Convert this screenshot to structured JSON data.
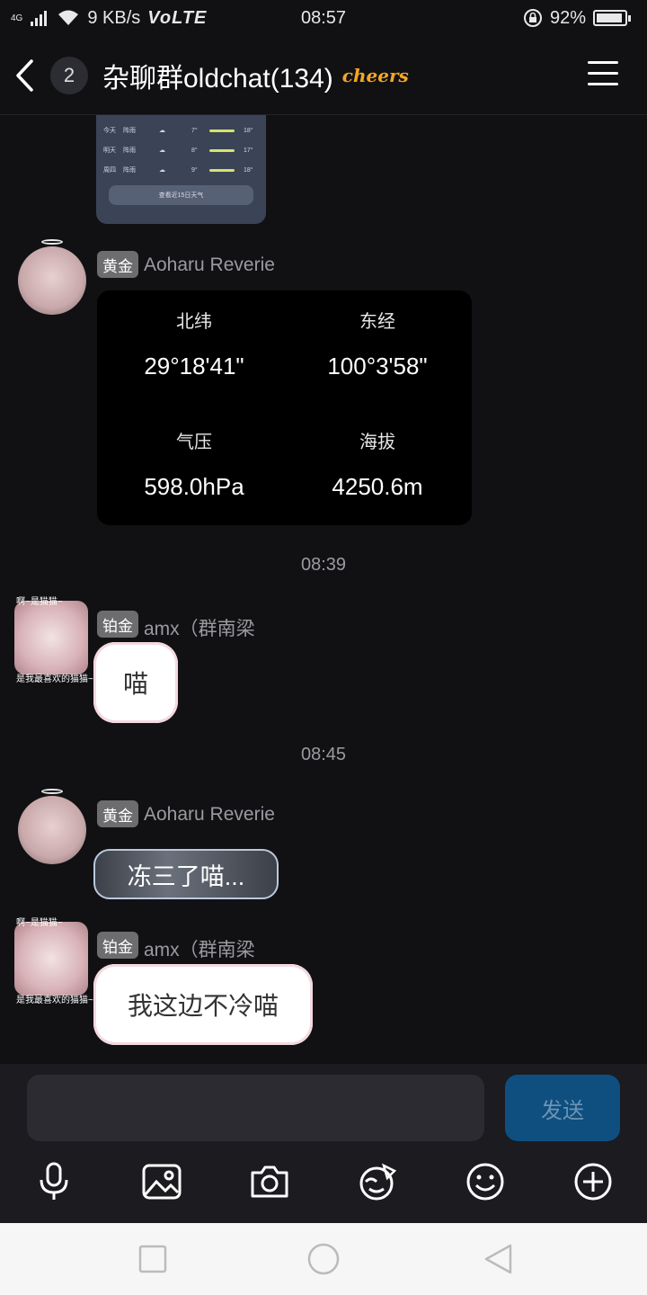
{
  "status_bar": {
    "network_type": "4G",
    "speed": "9 KB/s",
    "volte": "VoLTE",
    "time": "08:57",
    "battery_percent": "92%",
    "battery_level": 0.92
  },
  "header": {
    "unread_count": "2",
    "title": "杂聊群oldchat(134)",
    "title_tag": "cheers"
  },
  "weather_preview": {
    "rows": [
      {
        "day": "今天",
        "cond": "阵雨",
        "low": "7°",
        "high": "18°"
      },
      {
        "day": "明天",
        "cond": "阵雨",
        "low": "8°",
        "high": "17°"
      },
      {
        "day": "周四",
        "cond": "阵雨",
        "low": "9°",
        "high": "18°"
      }
    ],
    "button": "查看近15日天气"
  },
  "messages": [
    {
      "badge": "黄金",
      "sender": "Aoharu Reverie",
      "location_card": {
        "lat_label": "北纬",
        "lat_value": "29°18'41\"",
        "lon_label": "东经",
        "lon_value": "100°3'58\"",
        "pressure_label": "气压",
        "pressure_value": "598.0hPa",
        "altitude_label": "海拔",
        "altitude_value": "4250.6m"
      }
    },
    {
      "time_divider": "08:39"
    },
    {
      "badge": "铂金",
      "sender": "amx（群南梁",
      "avatar_text_top": "啊~是猫猫~",
      "avatar_text_bottom": "是我最喜欢的猫猫~",
      "sticker_text": "喵"
    },
    {
      "time_divider": "08:45"
    },
    {
      "badge": "黄金",
      "sender": "Aoharu Reverie",
      "sticker_text": "冻三了喵..."
    },
    {
      "badge": "铂金",
      "sender": "amx（群南梁",
      "avatar_text_top": "啊~是猫猫~",
      "avatar_text_bottom": "是我最喜欢的猫猫~",
      "sticker_text": "我这边不冷喵"
    }
  ],
  "input_bar": {
    "send_label": "发送",
    "tools": [
      "microphone-icon",
      "image-icon",
      "camera-icon",
      "sticker-icon",
      "emoji-icon",
      "plus-icon"
    ]
  },
  "nav_bar": {
    "buttons": [
      "recents-icon",
      "home-icon",
      "back-icon"
    ]
  }
}
